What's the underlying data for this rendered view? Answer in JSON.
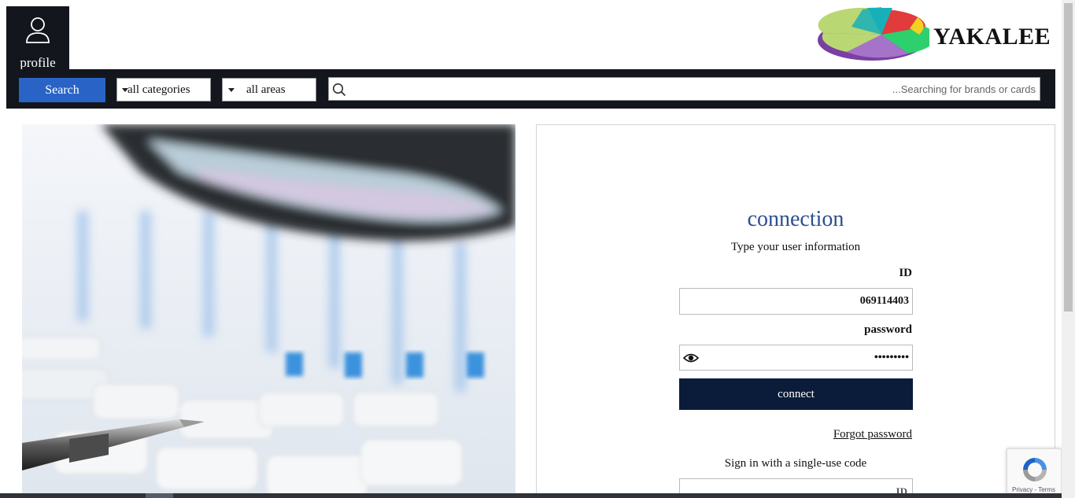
{
  "header": {
    "profile_label": "profile",
    "brand_name": "YAKALEE"
  },
  "searchbar": {
    "search_label": "Search",
    "category_selected": "all categories",
    "area_selected": "all areas",
    "query_placeholder": "...Searching for brands or cards"
  },
  "login": {
    "title": "connection",
    "subtitle": "Type your user information",
    "id_label": "ID",
    "id_value": "069114403",
    "password_label": "password",
    "password_value": "•••••••••",
    "connect_label": "connect",
    "forgot_label": "Forgot password",
    "single_use_label": "Sign in with a single-use code",
    "code_placeholder": "ID"
  },
  "recaptcha": {
    "text": "Privacy - Terms"
  },
  "colors": {
    "nav_bg": "#13161c",
    "search_button": "#2a63c6",
    "connect_button": "#0b1c3a",
    "title_blue": "#2b4f8f"
  },
  "icons": {
    "profile": "person-outline-icon",
    "search": "magnifier-icon",
    "password_toggle": "eye-icon",
    "recaptcha": "recaptcha-logo-icon"
  }
}
